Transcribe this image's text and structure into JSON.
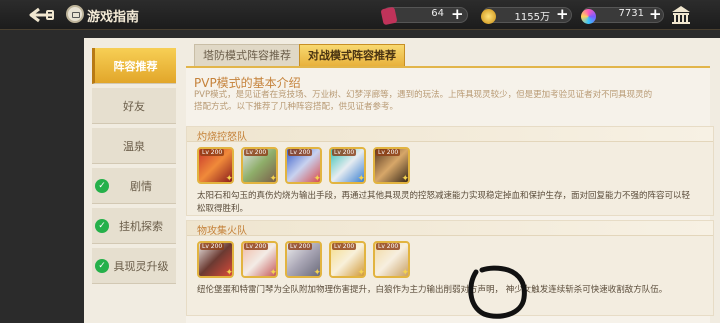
{
  "header": {
    "title": "游戏指南",
    "resources": [
      {
        "name": "gem",
        "value": "64"
      },
      {
        "name": "coin",
        "value": "1155万"
      },
      {
        "name": "orb",
        "value": "7731"
      }
    ]
  },
  "sidebar": {
    "items": [
      {
        "label": "阵容推荐",
        "active": true,
        "checked": false
      },
      {
        "label": "好友",
        "active": false,
        "checked": false
      },
      {
        "label": "温泉",
        "active": false,
        "checked": false
      },
      {
        "label": "剧情",
        "active": false,
        "checked": true
      },
      {
        "label": "挂机探索",
        "active": false,
        "checked": true
      },
      {
        "label": "具现灵升级",
        "active": false,
        "checked": true
      }
    ]
  },
  "tabs": [
    {
      "label": "塔防模式阵容推荐",
      "active": false
    },
    {
      "label": "对战模式阵容推荐",
      "active": true
    }
  ],
  "intro": {
    "title": "PVP模式的基本介绍",
    "text": "PVP模式，是见证者在竞技场、万业树、幻梦浮廊等，遇到的玩法。上阵具现灵较少，但是更加考验见证者对不同具现灵的搭配方式。以下推荐了几种阵容搭配，供见证者参考。"
  },
  "teams": [
    {
      "name": "灼烧控怒队",
      "cards": [
        {
          "level": "Lv 200",
          "icon": "character-portrait"
        },
        {
          "level": "Lv 200",
          "icon": "character-portrait"
        },
        {
          "level": "Lv 200",
          "icon": "character-portrait"
        },
        {
          "level": "Lv 200",
          "icon": "character-portrait"
        },
        {
          "level": "Lv 200",
          "icon": "character-portrait"
        }
      ],
      "desc": "太阳石和勾玉的真伤灼烧为输出手段，再通过其他具现灵的控怒减速能力实现稳定掉血和保护生存，面对回复能力不强的阵容可以轻松取得胜利。"
    },
    {
      "name": "物攻集火队",
      "cards": [
        {
          "level": "Lv 200",
          "icon": "character-portrait"
        },
        {
          "level": "Lv 200",
          "icon": "character-portrait"
        },
        {
          "level": "Lv 200",
          "icon": "character-portrait"
        },
        {
          "level": "Lv 200",
          "icon": "character-portrait"
        },
        {
          "level": "Lv 200",
          "icon": "character-portrait"
        }
      ],
      "desc": "纽伦堡蛋和特雷门琴为全队附加物理伤害提升，白狼作为主力输出削弱对方声明，  神少女触发连续斩杀可快速收割敌方队伍。"
    }
  ],
  "colors": {
    "accent": "#e8b13c",
    "brand_text": "#c5823a",
    "check": "#25b04a"
  }
}
